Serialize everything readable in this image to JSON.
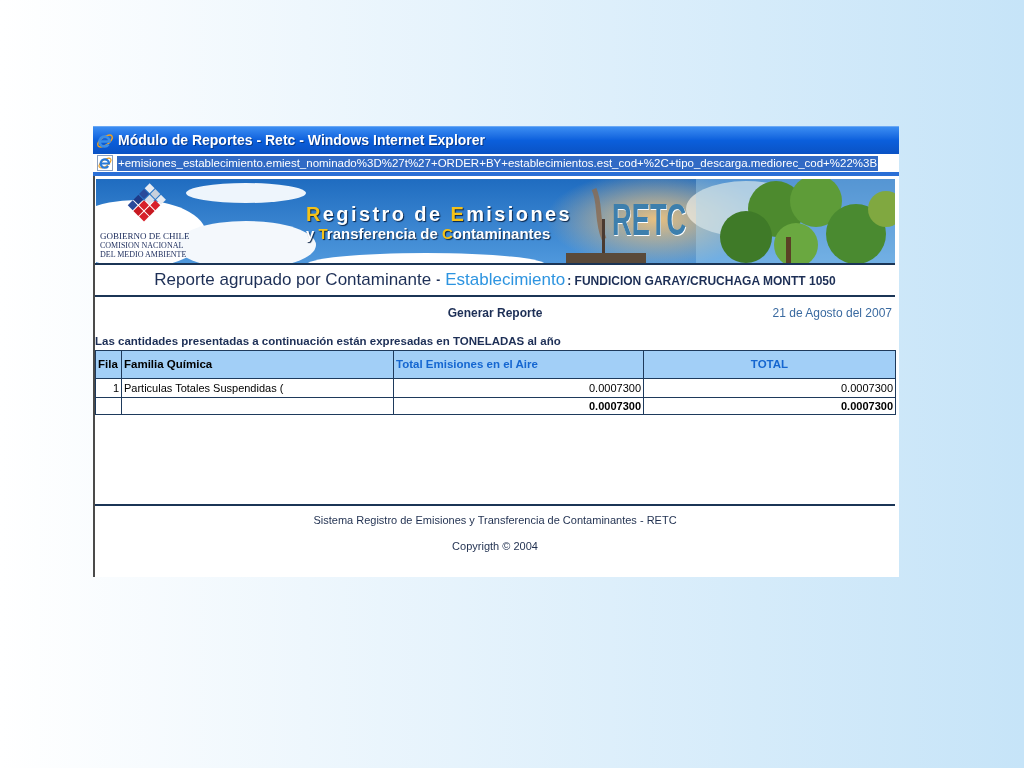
{
  "window": {
    "title": "Módulo de Reportes - Retc - Windows Internet Explorer"
  },
  "address_bar": {
    "value": "+emisiones_establecimiento.emiest_nominado%3D%27t%27+ORDER+BY+establecimientos.est_cod+%2C+tipo_descarga.mediorec_cod+%22%3B",
    "selected": true
  },
  "banner": {
    "logo_lines": [
      "GOBIERNO DE CHILE",
      "COMISION NACIONAL",
      "DEL MEDIO AMBIENTE"
    ],
    "title_lines": [
      [
        {
          "text": "R",
          "highlight": true
        },
        {
          "text": "egistro de ",
          "highlight": false
        },
        {
          "text": "E",
          "highlight": true
        },
        {
          "text": "misiones",
          "highlight": false
        }
      ],
      [
        {
          "text": "y ",
          "highlight": false
        },
        {
          "text": "T",
          "highlight": true
        },
        {
          "text": "ransferencia de ",
          "highlight": false
        },
        {
          "text": "C",
          "highlight": true
        },
        {
          "text": "ontaminantes",
          "highlight": false
        }
      ]
    ],
    "acronym": "RETC"
  },
  "report": {
    "title": "Reporte agrupado por Contaminante",
    "separator": "-",
    "entity_label": "Establecimiento",
    "entity_value": ": FUNDICION GARAY/CRUCHAGA MONTT 1050",
    "action": "Generar Reporte",
    "date": "21 de Agosto del 2007",
    "note": "Las cantidades presentadas a continuación están expresadas en TONELADAS al año"
  },
  "table": {
    "columns": [
      {
        "label": "Fila",
        "kind": "plain"
      },
      {
        "label": "Familia Química",
        "kind": "plain"
      },
      {
        "label": "Total Emisiones en el Aire",
        "kind": "accent"
      },
      {
        "label": "TOTAL",
        "kind": "centered"
      }
    ],
    "rows": [
      {
        "kind": "data",
        "cells": [
          "1",
          "Particulas Totales Suspendidas (",
          "0.0007300",
          "0.0007300"
        ]
      },
      {
        "kind": "total",
        "cells": [
          "",
          "",
          "0.0007300",
          "0.0007300"
        ]
      }
    ]
  },
  "footer": {
    "lines": [
      "Sistema Registro de Emisiones y Transferencia de Contaminantes - RETC",
      "Copyrigth © 2004"
    ]
  }
}
